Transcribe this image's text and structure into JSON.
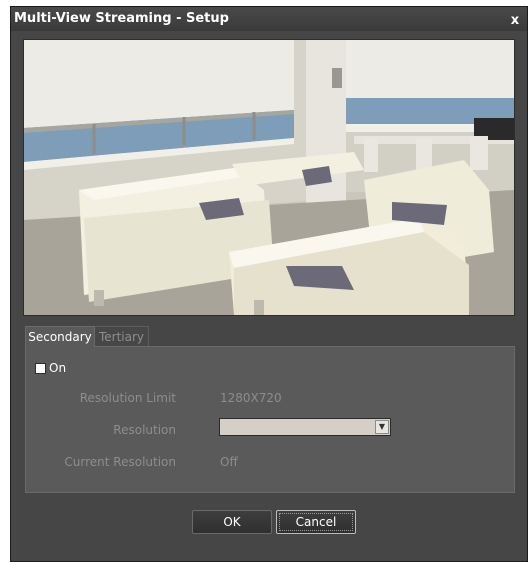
{
  "window": {
    "title": "Multi-View Streaming - Setup",
    "close_label": "x"
  },
  "tabs": [
    {
      "label": "Secondary",
      "active": true
    },
    {
      "label": "Tertiary",
      "active": false
    }
  ],
  "settings": {
    "on_label": "On",
    "on_checked": false,
    "resolution_limit_label": "Resolution Limit",
    "resolution_limit_value": "1280X720",
    "resolution_label": "Resolution",
    "resolution_value": "",
    "current_resolution_label": "Current Resolution",
    "current_resolution_value": "Off"
  },
  "buttons": {
    "ok_label": "OK",
    "cancel_label": "Cancel"
  },
  "colors": {
    "window_bg": "#464646",
    "panel_bg": "#5a5a5a",
    "disabled_text": "#8d8d8d"
  }
}
